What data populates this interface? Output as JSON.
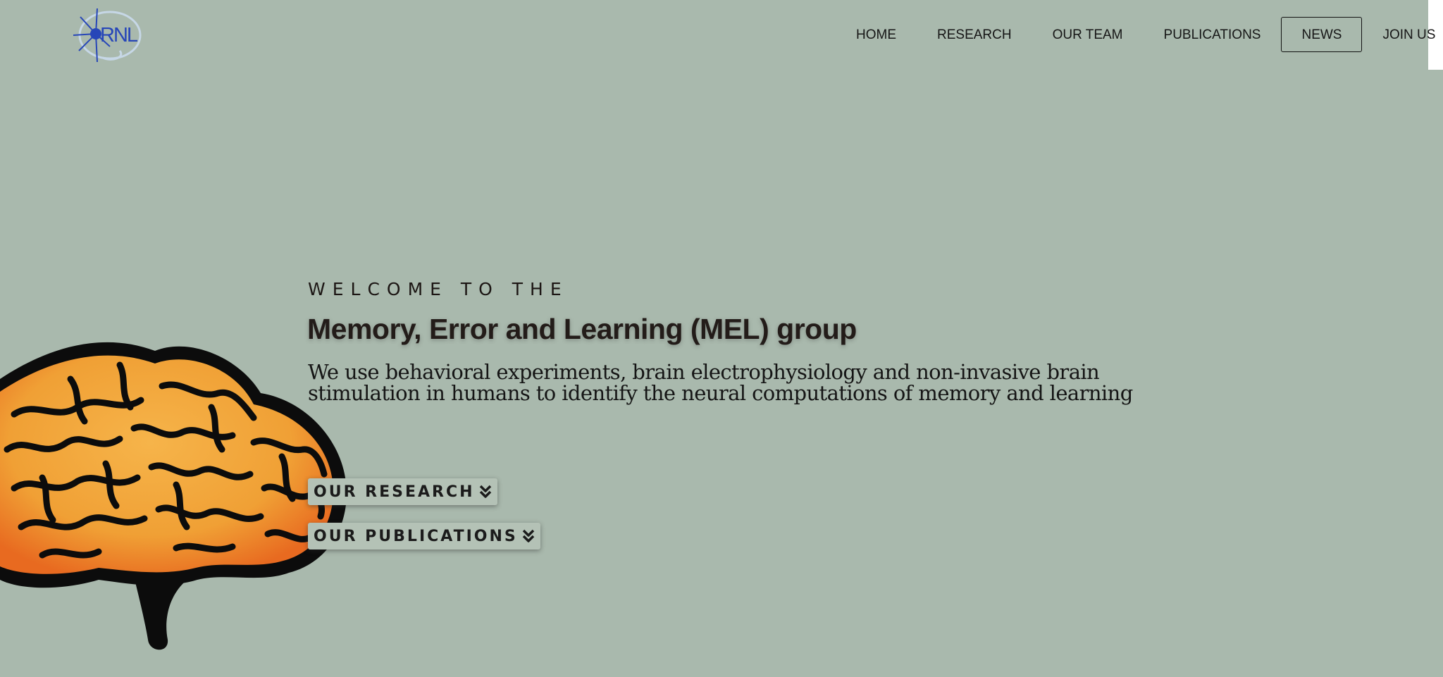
{
  "brand": {
    "logo_text": "RNL"
  },
  "nav": {
    "items": [
      {
        "label": "HOME"
      },
      {
        "label": "RESEARCH"
      },
      {
        "label": "OUR TEAM"
      },
      {
        "label": "PUBLICATIONS"
      },
      {
        "label": "NEWS",
        "active": true
      },
      {
        "label": "JOIN US"
      }
    ]
  },
  "hero": {
    "welcome": "WELCOME TO THE",
    "title": "Memory, Error and Learning (MEL) group",
    "tagline": "We use behavioral experiments, brain electrophysiology and non-invasive brain stimulation in humans to identify the neural computations of memory and learning",
    "buttons": {
      "research": "OUR RESEARCH",
      "publications": "OUR PUBLICATIONS"
    }
  },
  "colors": {
    "background": "#a9b9ad",
    "logo_accent": "#2746b8",
    "brain_fill": "#f2a23a",
    "brain_outline": "#0c0c0c"
  },
  "icons": {
    "logo": "rnl-logo-icon",
    "button_chevron": "double-chevron-down-icon",
    "illustration": "brain-illustration"
  }
}
